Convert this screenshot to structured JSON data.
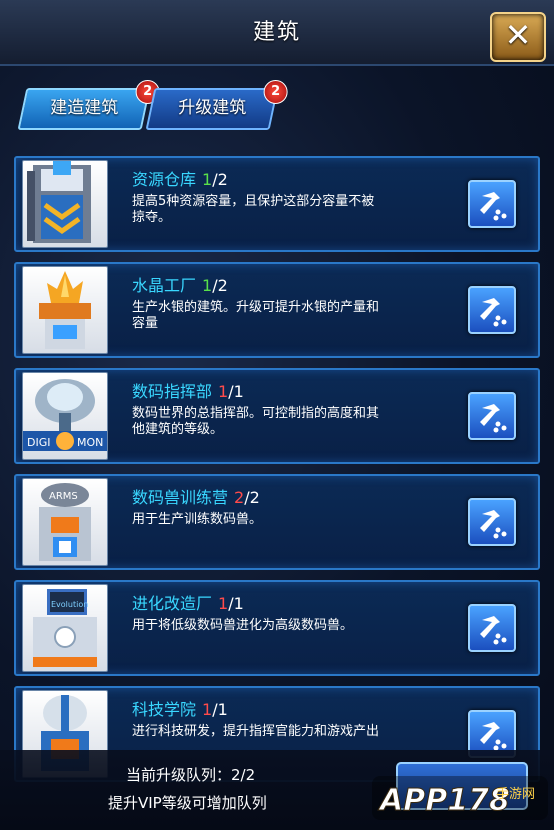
{
  "window": {
    "title": "建筑",
    "close_icon": "close-icon"
  },
  "tabs": [
    {
      "label": "建造建筑",
      "badge": "2",
      "active": true
    },
    {
      "label": "升级建筑",
      "badge": "2",
      "active": false
    }
  ],
  "buildings": [
    {
      "name": "资源仓库",
      "level": "1",
      "max": "/2",
      "level_color": "#59e04a",
      "desc": "提高5种资源容量，且保护这部分容量不被掠夺。",
      "icon": "warehouse-icon"
    },
    {
      "name": "水晶工厂",
      "level": "1",
      "max": "/2",
      "level_color": "#59e04a",
      "desc": "生产水银的建筑。升级可提升水银的产量和容量",
      "icon": "crystal-factory-icon"
    },
    {
      "name": "数码指挥部",
      "level": "1",
      "max": "/1",
      "level_color": "#ff4b4b",
      "desc": "数码世界的总指挥部。可控制指的高度和其他建筑的等级。",
      "icon": "command-center-icon",
      "icon_text_left": "DIGI",
      "icon_text_right": "MON"
    },
    {
      "name": "数码兽训练营",
      "level": "2",
      "max": "/2",
      "level_color": "#ff4b4b",
      "desc": "用于生产训练数码兽。",
      "icon": "training-camp-icon",
      "icon_text": "ARMS"
    },
    {
      "name": "进化改造厂",
      "level": "1",
      "max": "/1",
      "level_color": "#ff4b4b",
      "desc": "用于将低级数码兽进化为高级数码兽。",
      "icon": "evolution-factory-icon",
      "icon_text": "Evolution"
    },
    {
      "name": "科技学院",
      "level": "1",
      "max": "/1",
      "level_color": "#ff4b4b",
      "desc": "进行科技研发，提升指挥官能力和游戏产出",
      "icon": "tech-academy-icon"
    }
  ],
  "upgrade_button_icon": "hammer-icon",
  "footer": {
    "queue": "当前升级队列：2/2",
    "vip_tip": "提升VIP等级可增加队列"
  },
  "watermark": {
    "text": "APP178",
    "sub": "手游网"
  },
  "colors": {
    "name": "#39d7ff",
    "card_border": "#2a78c8",
    "level_ok": "#59e04a",
    "level_max": "#ff4b4b"
  }
}
